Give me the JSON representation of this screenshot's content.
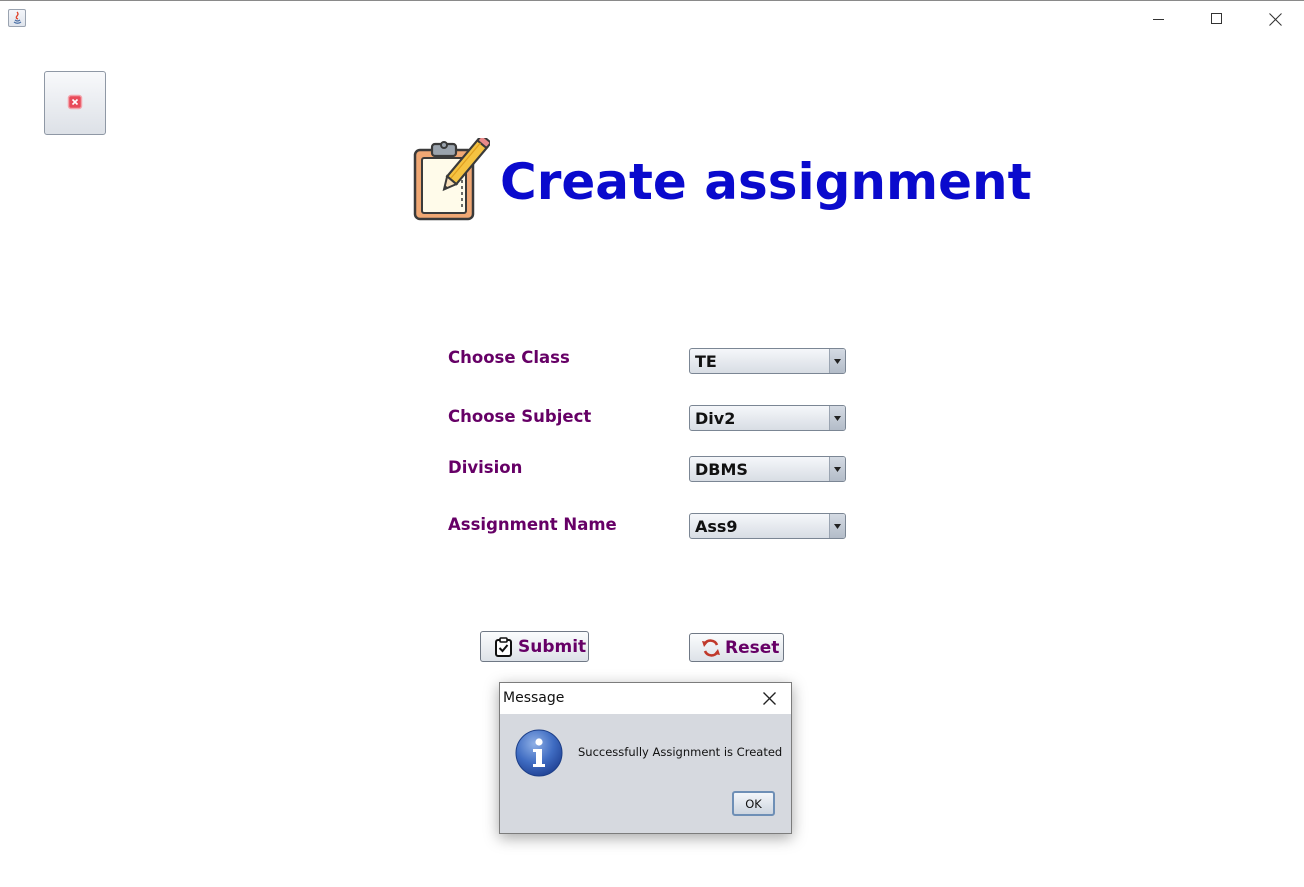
{
  "window": {
    "minimize_icon": "minimize-icon",
    "maximize_icon": "maximize-icon",
    "close_icon": "close-icon"
  },
  "header": {
    "title": "Create assignment",
    "icon": "clipboard-pencil-icon",
    "title_color": "#0a0acd"
  },
  "form": {
    "fields": [
      {
        "label": "Choose Class",
        "value": "TE"
      },
      {
        "label": "Choose Subject",
        "value": "Div2"
      },
      {
        "label": "Division",
        "value": "DBMS"
      },
      {
        "label": "Assignment Name",
        "value": "Ass9"
      }
    ],
    "label_color": "#660066",
    "submit_label": "Submit",
    "reset_label": "Reset"
  },
  "dialog": {
    "title": "Message",
    "message": "Successfully Assignment is Created",
    "ok_label": "OK",
    "icon": "info-icon"
  }
}
